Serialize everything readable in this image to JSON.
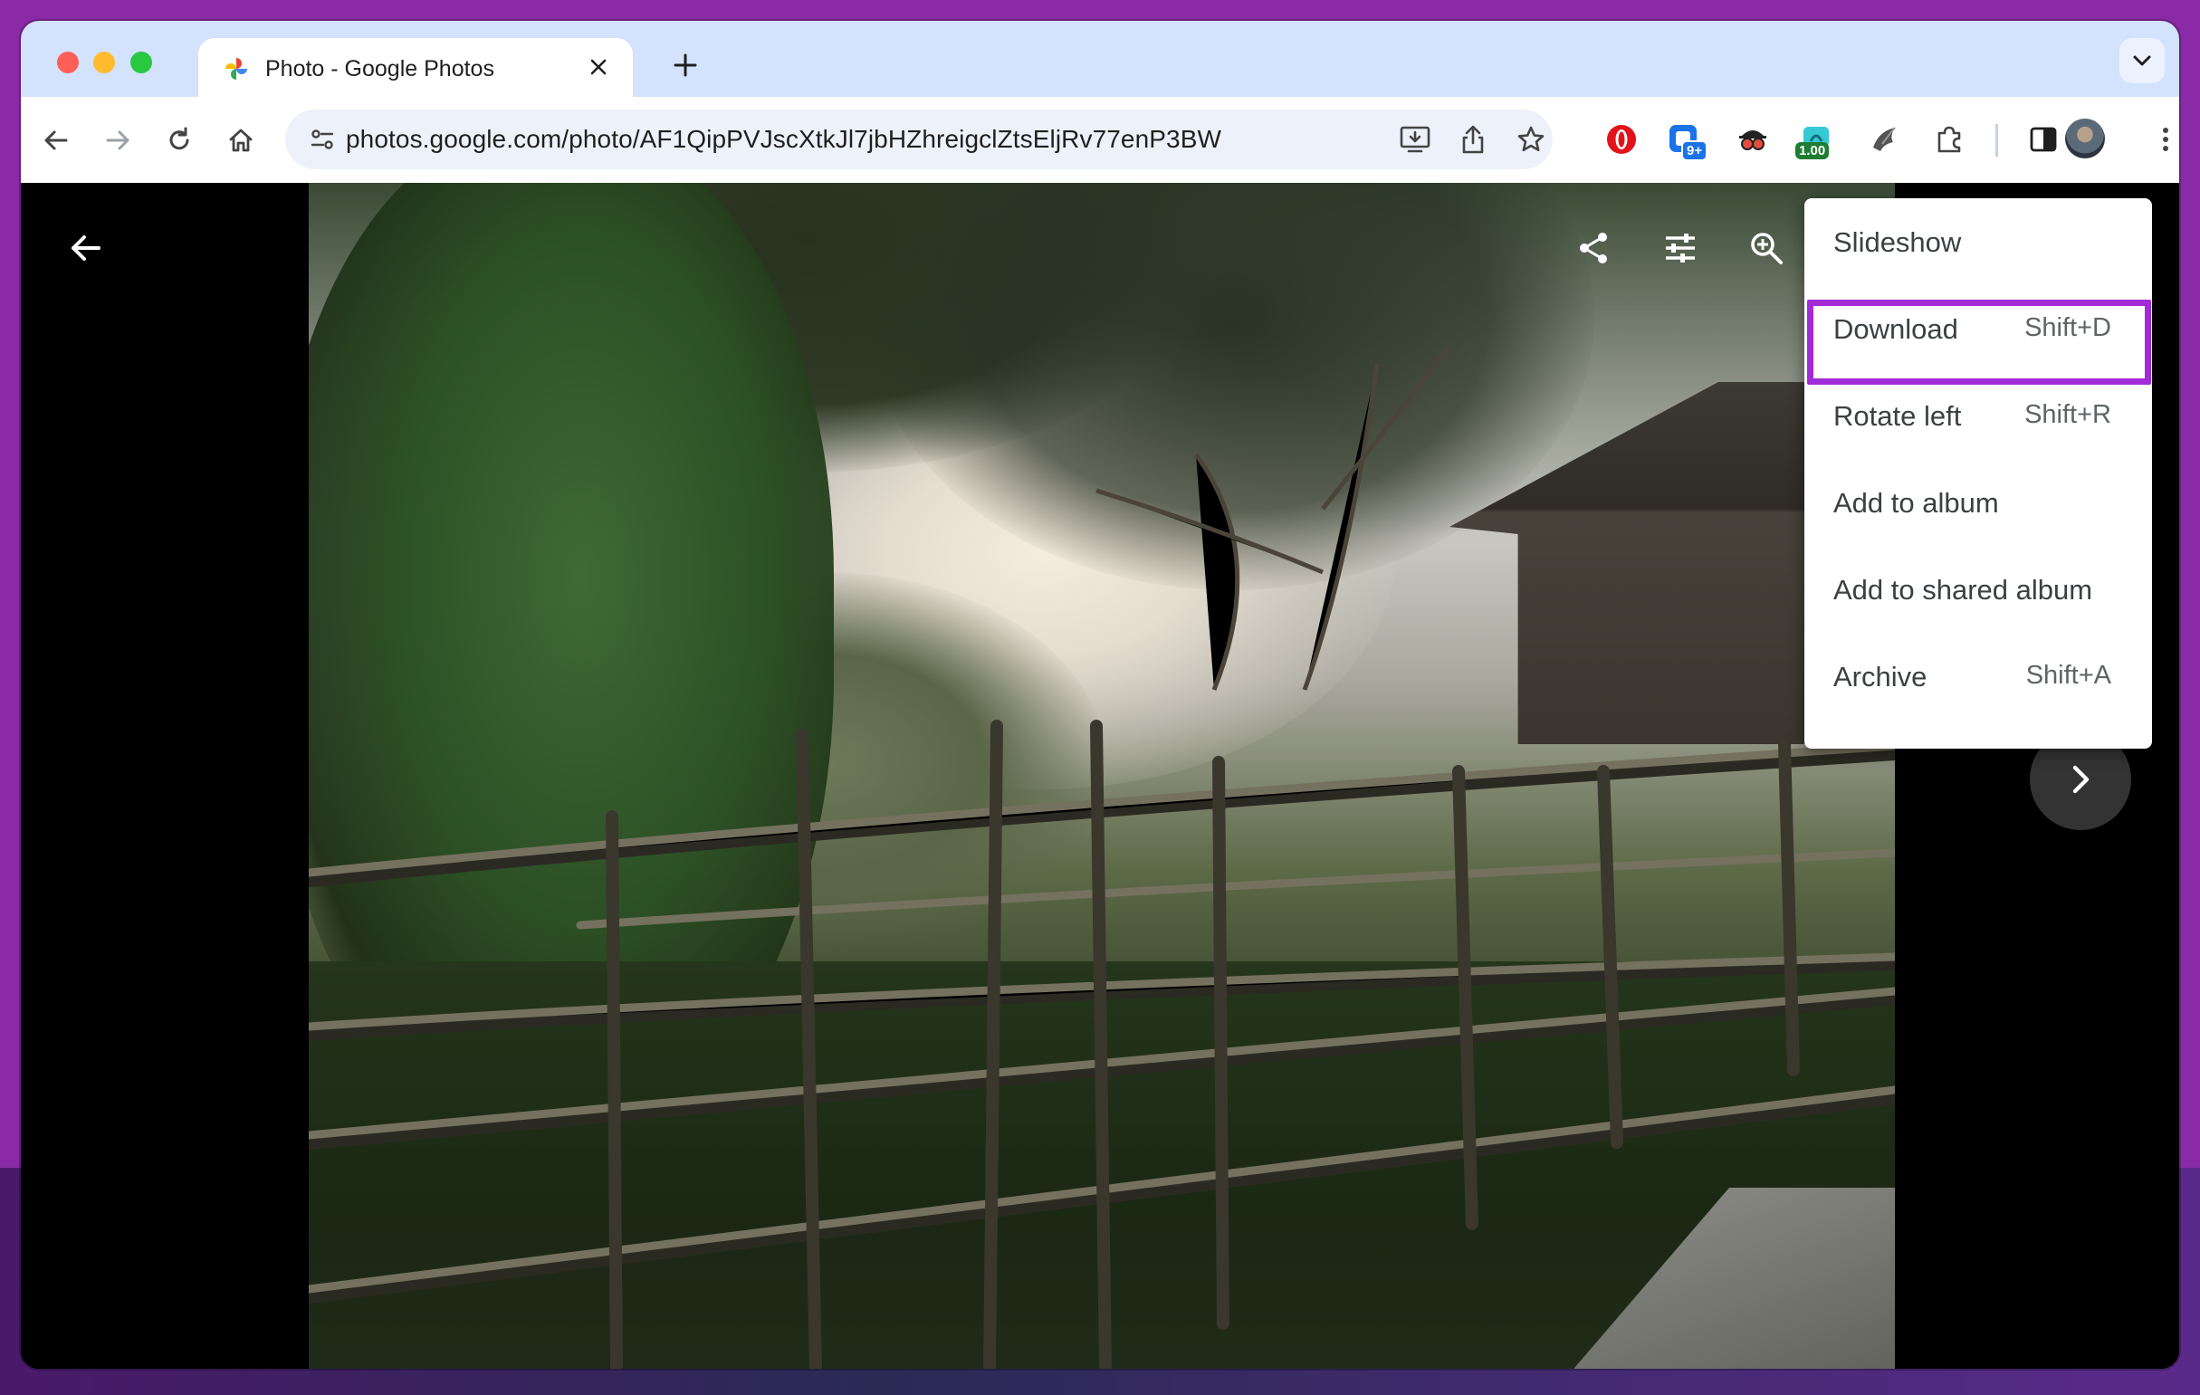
{
  "browser": {
    "tab": {
      "title": "Photo - Google Photos"
    },
    "url": "photos.google.com/photo/AF1QipPVJscXtkJl7jbHZhreigclZtsEljRv77enP3BW",
    "extensions": [
      {
        "name": "opera-icon",
        "badge": ""
      },
      {
        "name": "extension-badge-icon",
        "badge": "9+"
      },
      {
        "name": "spy-icon",
        "badge": ""
      },
      {
        "name": "speed-icon",
        "badge": "1.00"
      },
      {
        "name": "bird-icon",
        "badge": ""
      }
    ]
  },
  "menu": {
    "items": [
      {
        "label": "Slideshow",
        "shortcut": ""
      },
      {
        "label": "Download",
        "shortcut": "Shift+D"
      },
      {
        "label": "Rotate left",
        "shortcut": "Shift+R"
      },
      {
        "label": "Add to album",
        "shortcut": ""
      },
      {
        "label": "Add to shared album",
        "shortcut": ""
      },
      {
        "label": "Archive",
        "shortcut": "Shift+A"
      }
    ],
    "highlighted": "Download"
  },
  "colors": {
    "frame": "#8a2aa6",
    "highlight": "#a22bd8",
    "tabstrip": "#d3e3fd"
  }
}
